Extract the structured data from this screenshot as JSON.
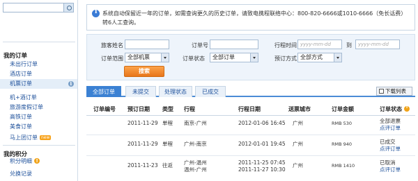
{
  "sidebar": {
    "section1_title": "我的订单",
    "items": [
      {
        "label": "未出行订单"
      },
      {
        "label": "酒店订单"
      },
      {
        "label": "机票订单"
      },
      {
        "label": "机+酒订单"
      },
      {
        "label": "旅游度假订单"
      },
      {
        "label": "高铁订单"
      },
      {
        "label": "美食订单"
      },
      {
        "label": "马上团订单",
        "badge": "new"
      }
    ],
    "section2_title": "我的积分",
    "items2": [
      {
        "label": "积分明细"
      },
      {
        "label": "兑换记录"
      }
    ]
  },
  "notice": {
    "text": "系统自动保留近一年的订单，如需查询更久的历史订单，请致电携程联络中心：800-820-6666或1010-6666（免长话费）转6人工查询。"
  },
  "search": {
    "passenger_label": "旅客姓名",
    "order_no_label": "订单号",
    "travel_time_label": "行程时间",
    "date_from_placeholder": "yyyy-mm-dd",
    "to_label": "到",
    "date_to_placeholder": "yyyy-mm-dd",
    "order_range_label": "订单范围",
    "order_range_value": "全部机票",
    "order_status_label": "订单状态",
    "order_status_value": "全部订单",
    "booking_method_label": "预订方式",
    "booking_method_value": "全部方式",
    "submit_label": "搜索"
  },
  "tabs": [
    {
      "label": "全部订单",
      "active": true
    },
    {
      "label": "未提交"
    },
    {
      "label": "处理状态"
    },
    {
      "label": "已成交"
    }
  ],
  "download_label": "下载列表",
  "table": {
    "headers": [
      "订单编号",
      "预订日期",
      "类型",
      "行程",
      "行程日期",
      "送票城市",
      "订单金额",
      "订单状态"
    ],
    "rows": [
      {
        "book_date": "2011-11-29",
        "type": "单程",
        "route": [
          "南京-广州"
        ],
        "travel_date": [
          "2012-01-06 16:45"
        ],
        "city": "广州",
        "amount": "RMB 530",
        "status": "全部退票",
        "action": "点评订单"
      },
      {
        "book_date": "2011-11-29",
        "type": "单程",
        "route": [
          "广州-南京"
        ],
        "travel_date": [
          "2012-01-01 19:45"
        ],
        "city": "广州",
        "amount": "RMB 940",
        "status": "已成交",
        "action": "点评订单"
      },
      {
        "book_date": "2011-11-23",
        "type": "往返",
        "route": [
          "广州-温州",
          "温州-广州"
        ],
        "travel_date": [
          "2011-11-25 07:45",
          "2011-11-27 10:30"
        ],
        "city": "广州",
        "amount": "RMB 1410",
        "status": "已取消",
        "action": "点评订单"
      }
    ]
  }
}
